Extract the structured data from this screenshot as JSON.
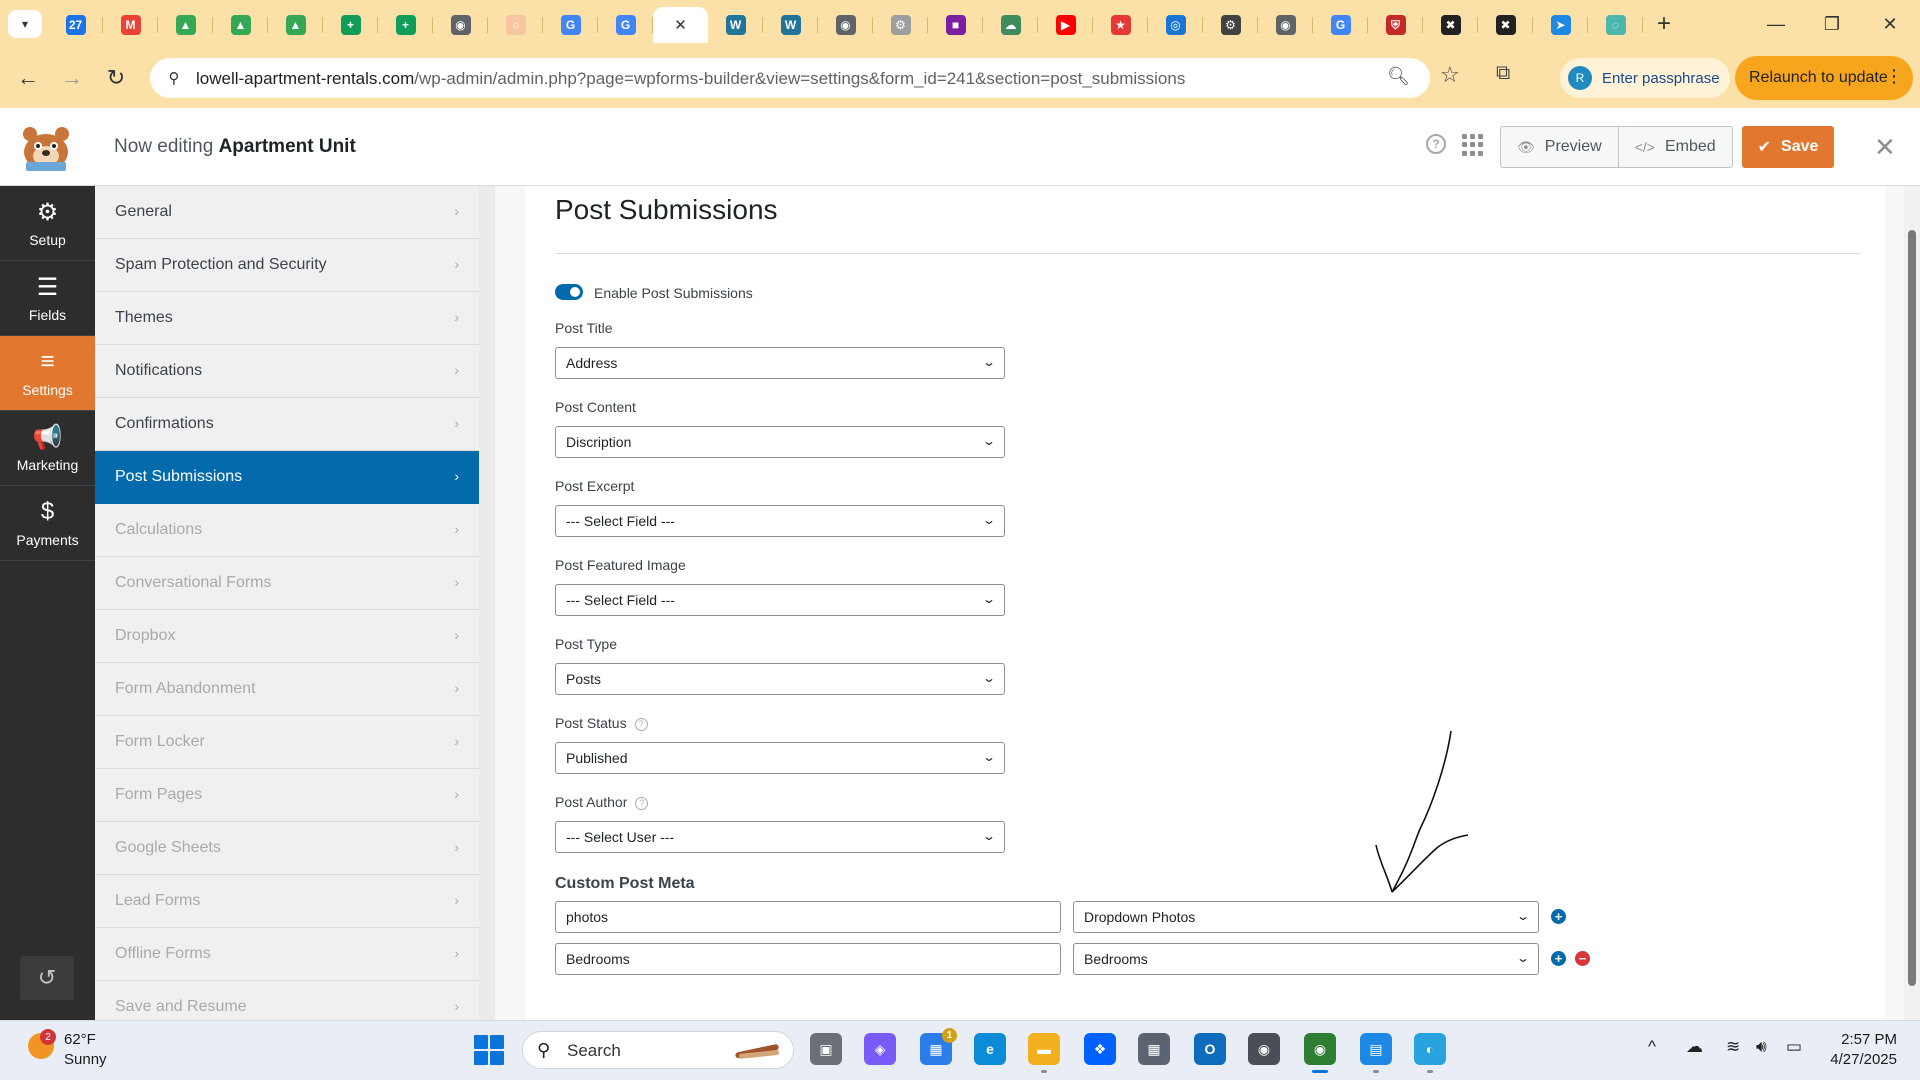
{
  "browser": {
    "tabs": [
      {
        "icon": "calendar-icon",
        "color": "#1a73e8",
        "glyph": "27"
      },
      {
        "icon": "gmail-icon",
        "color": "#ea4335",
        "glyph": "M"
      },
      {
        "icon": "drive-icon",
        "color": "#34a853",
        "glyph": "▲"
      },
      {
        "icon": "drive-icon",
        "color": "#34a853",
        "glyph": "▲"
      },
      {
        "icon": "drive-icon",
        "color": "#34a853",
        "glyph": "▲"
      },
      {
        "icon": "sheets-plus-icon",
        "color": "#0f9d58",
        "glyph": "+"
      },
      {
        "icon": "sheets-plus-icon",
        "color": "#0f9d58",
        "glyph": "+"
      },
      {
        "icon": "chrome-gray-icon",
        "color": "#5f6368",
        "glyph": "◉"
      },
      {
        "icon": "loading-icon",
        "color": "#f6c7a0",
        "glyph": "○"
      },
      {
        "icon": "google-icon",
        "color": "#4285f4",
        "glyph": "G"
      },
      {
        "icon": "google-icon",
        "color": "#4285f4",
        "glyph": "G"
      },
      {
        "icon": "active-tab-close-icon",
        "color": "#ffffff",
        "glyph": "✕"
      },
      {
        "icon": "wordpress-icon",
        "color": "#21759b",
        "glyph": "W"
      },
      {
        "icon": "wordpress-icon",
        "color": "#21759b",
        "glyph": "W"
      },
      {
        "icon": "globe-icon",
        "color": "#5f6368",
        "glyph": "◉"
      },
      {
        "icon": "gear-tab-icon",
        "color": "#9e9e9e",
        "glyph": "⚙"
      },
      {
        "icon": "app-purple-icon",
        "color": "#7b1fa2",
        "glyph": "■"
      },
      {
        "icon": "cloud-icon",
        "color": "#3d8b5e",
        "glyph": "☁"
      },
      {
        "icon": "youtube-icon",
        "color": "#ff0000",
        "glyph": "▶"
      },
      {
        "icon": "star-red-icon",
        "color": "#e53935",
        "glyph": "★"
      },
      {
        "icon": "target-icon",
        "color": "#1976d2",
        "glyph": "◎"
      },
      {
        "icon": "settings-tab-icon",
        "color": "#424242",
        "glyph": "⚙"
      },
      {
        "icon": "chrome-gray-icon",
        "color": "#5f6368",
        "glyph": "◉"
      },
      {
        "icon": "google-icon",
        "color": "#4285f4",
        "glyph": "G"
      },
      {
        "icon": "shield-red-icon",
        "color": "#c62828",
        "glyph": "⛨"
      },
      {
        "icon": "badge-dark-icon",
        "color": "#212121",
        "glyph": "✖"
      },
      {
        "icon": "badge-dark-icon",
        "color": "#212121",
        "glyph": "✖"
      },
      {
        "icon": "send-blue-icon",
        "color": "#1e88e5",
        "glyph": "➤"
      },
      {
        "icon": "shield-teal-icon",
        "color": "#4db6ac",
        "glyph": "◌"
      }
    ],
    "url_host": "lowell-apartment-rentals.com",
    "url_path": "/wp-admin/admin.php?page=wpforms-builder&view=settings&form_id=241&section=post_submissions",
    "passphrase_label": "Enter passphrase",
    "avatar_letter": "R",
    "relaunch_label": "Relaunch to update"
  },
  "header": {
    "editing_prefix": "Now editing",
    "form_name": "Apartment Unit",
    "preview_label": "Preview",
    "embed_label": "Embed",
    "save_label": "Save"
  },
  "leftnav": [
    {
      "label": "Setup",
      "icon": "gear-icon",
      "glyph": "⚙"
    },
    {
      "label": "Fields",
      "icon": "fields-list-icon",
      "glyph": "☰"
    },
    {
      "label": "Settings",
      "icon": "sliders-icon",
      "glyph": "≡",
      "active": true
    },
    {
      "label": "Marketing",
      "icon": "megaphone-icon",
      "glyph": "📢"
    },
    {
      "label": "Payments",
      "icon": "dollar-icon",
      "glyph": "$"
    }
  ],
  "settings_menu": [
    {
      "label": "General",
      "state": "normal"
    },
    {
      "label": "Spam Protection and Security",
      "state": "normal"
    },
    {
      "label": "Themes",
      "state": "normal"
    },
    {
      "label": "Notifications",
      "state": "normal"
    },
    {
      "label": "Confirmations",
      "state": "normal"
    },
    {
      "label": "Post Submissions",
      "state": "active"
    },
    {
      "label": "Calculations",
      "state": "dim"
    },
    {
      "label": "Conversational Forms",
      "state": "dim"
    },
    {
      "label": "Dropbox",
      "state": "dim"
    },
    {
      "label": "Form Abandonment",
      "state": "dim"
    },
    {
      "label": "Form Locker",
      "state": "dim"
    },
    {
      "label": "Form Pages",
      "state": "dim"
    },
    {
      "label": "Google Sheets",
      "state": "dim"
    },
    {
      "label": "Lead Forms",
      "state": "dim"
    },
    {
      "label": "Offline Forms",
      "state": "dim"
    },
    {
      "label": "Save and Resume",
      "state": "dim"
    }
  ],
  "content": {
    "title": "Post Submissions",
    "toggle_label": "Enable Post Submissions",
    "toggle_on": true,
    "fields": [
      {
        "label": "Post Title",
        "value": "Address",
        "help": false
      },
      {
        "label": "Post Content",
        "value": "Discription",
        "help": false
      },
      {
        "label": "Post Excerpt",
        "value": "--- Select Field ---",
        "help": false
      },
      {
        "label": "Post Featured Image",
        "value": "--- Select Field ---",
        "help": false
      },
      {
        "label": "Post Type",
        "value": "Posts",
        "help": false
      },
      {
        "label": "Post Status",
        "value": "Published",
        "help": true
      },
      {
        "label": "Post Author",
        "value": "--- Select User ---",
        "help": true
      }
    ],
    "meta_title": "Custom Post Meta",
    "meta_rows": [
      {
        "key": "photos",
        "field": "Dropdown Photos",
        "can_remove": false
      },
      {
        "key": "Bedrooms",
        "field": "Bedrooms",
        "can_remove": true
      }
    ]
  },
  "taskbar": {
    "weather_badge": "2",
    "temperature": "62°F",
    "condition": "Sunny",
    "search_label": "Search",
    "apps": [
      {
        "name": "task-view-icon",
        "color": "#6b6f78",
        "glyph": "▣",
        "state": ""
      },
      {
        "name": "copilot-icon",
        "color": "#7a5af8",
        "glyph": "◈",
        "state": ""
      },
      {
        "name": "store-icon",
        "color": "#2b7de9",
        "glyph": "▦",
        "state": "",
        "badge": "1"
      },
      {
        "name": "edge-icon",
        "color": "#0c8bd6",
        "glyph": "e",
        "state": ""
      },
      {
        "name": "file-explorer-icon",
        "color": "#f2b01e",
        "glyph": "▬",
        "state": "open"
      },
      {
        "name": "dropbox-icon",
        "color": "#0061fe",
        "glyph": "❖",
        "state": ""
      },
      {
        "name": "calculator-icon",
        "color": "#5b6470",
        "glyph": "▦",
        "state": ""
      },
      {
        "name": "outlook-icon",
        "color": "#0f6cbd",
        "glyph": "O",
        "state": ""
      },
      {
        "name": "camera-icon",
        "color": "#4a4f57",
        "glyph": "◉",
        "state": ""
      },
      {
        "name": "chrome-icon",
        "color": "#2e7d32",
        "glyph": "◉",
        "state": "active"
      },
      {
        "name": "notepad-icon",
        "color": "#1e88e5",
        "glyph": "▤",
        "state": "open"
      },
      {
        "name": "browser-blue-icon",
        "color": "#29a3e0",
        "glyph": "◐",
        "state": "open"
      }
    ],
    "time": "2:57 PM",
    "date": "4/27/2025"
  }
}
